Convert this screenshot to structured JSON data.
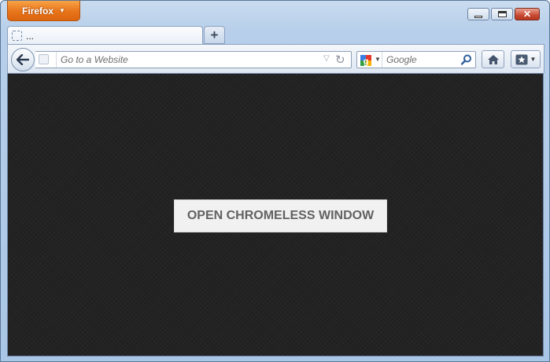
{
  "window": {
    "app_button_label": "Firefox",
    "controls": [
      "minimize-icon",
      "maximize-icon",
      "close-icon"
    ]
  },
  "tabs": [
    {
      "title": "...",
      "icon": "blank-page-icon",
      "active": true
    }
  ],
  "new_tab_label": "+",
  "navbar": {
    "url_placeholder": "Go to a Website",
    "search_placeholder": "Google",
    "search_engine_icon": "google-icon"
  },
  "content": {
    "button_label": "OPEN CHROMELESS WINDOW"
  },
  "colors": {
    "firefox_orange": "#e8741a",
    "content_background": "#232323",
    "button_background": "#f1f1f1",
    "button_text": "#626262",
    "close_red": "#c94a33"
  }
}
